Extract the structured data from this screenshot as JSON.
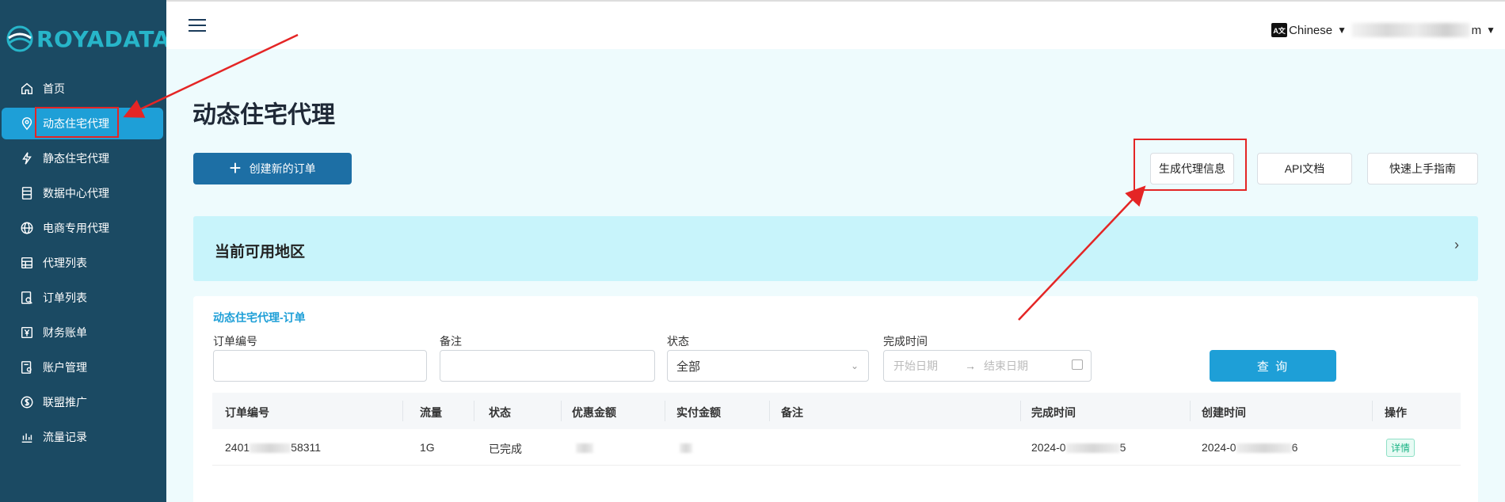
{
  "brand": {
    "name": "ROYADATA"
  },
  "sidebar": {
    "items": [
      {
        "label": "首页",
        "icon": "home-icon"
      },
      {
        "label": "动态住宅代理",
        "icon": "location-pin-icon"
      },
      {
        "label": "静态住宅代理",
        "icon": "lightning-icon"
      },
      {
        "label": "数据中心代理",
        "icon": "server-icon"
      },
      {
        "label": "电商专用代理",
        "icon": "globe-icon"
      },
      {
        "label": "代理列表",
        "icon": "list-icon"
      },
      {
        "label": "订单列表",
        "icon": "order-search-icon"
      },
      {
        "label": "财务账单",
        "icon": "yen-bill-icon"
      },
      {
        "label": "账户管理",
        "icon": "account-icon"
      },
      {
        "label": "联盟推广",
        "icon": "dollar-circle-icon"
      },
      {
        "label": "流量记录",
        "icon": "bar-chart-icon"
      }
    ],
    "active_index": 1
  },
  "topbar": {
    "language": "Chinese",
    "lang_icon_text": "A文",
    "user_suffix": "m"
  },
  "page": {
    "title": "动态住宅代理",
    "create_button": "创建新的订单",
    "generate_button": "生成代理信息",
    "api_button": "API文档",
    "guide_button": "快速上手指南",
    "region_title": "当前可用地区",
    "region_arrow": "›"
  },
  "orders": {
    "card_title": "动态住宅代理-订单",
    "filters": {
      "order_no_label": "订单编号",
      "remark_label": "备注",
      "status_label": "状态",
      "status_value": "全部",
      "time_label": "完成时间",
      "start_placeholder": "开始日期",
      "end_placeholder": "结束日期",
      "range_arrow": "→",
      "query_button": "查 询"
    },
    "columns": [
      "订单编号",
      "流量",
      "状态",
      "优惠金额",
      "实付金额",
      "备注",
      "完成时间",
      "创建时间",
      "操作"
    ],
    "rows": [
      {
        "order_no_prefix": "2401",
        "order_no_suffix": "58311",
        "traffic": "1G",
        "status": "已完成",
        "remark": "",
        "finish_time_prefix": "2024-0",
        "finish_time_suffix": "5",
        "create_time_prefix": "2024-0",
        "create_time_suffix": "6",
        "action": "详情"
      }
    ]
  },
  "annotation_color": "#e42525",
  "accent_color": "#1e9fd7"
}
